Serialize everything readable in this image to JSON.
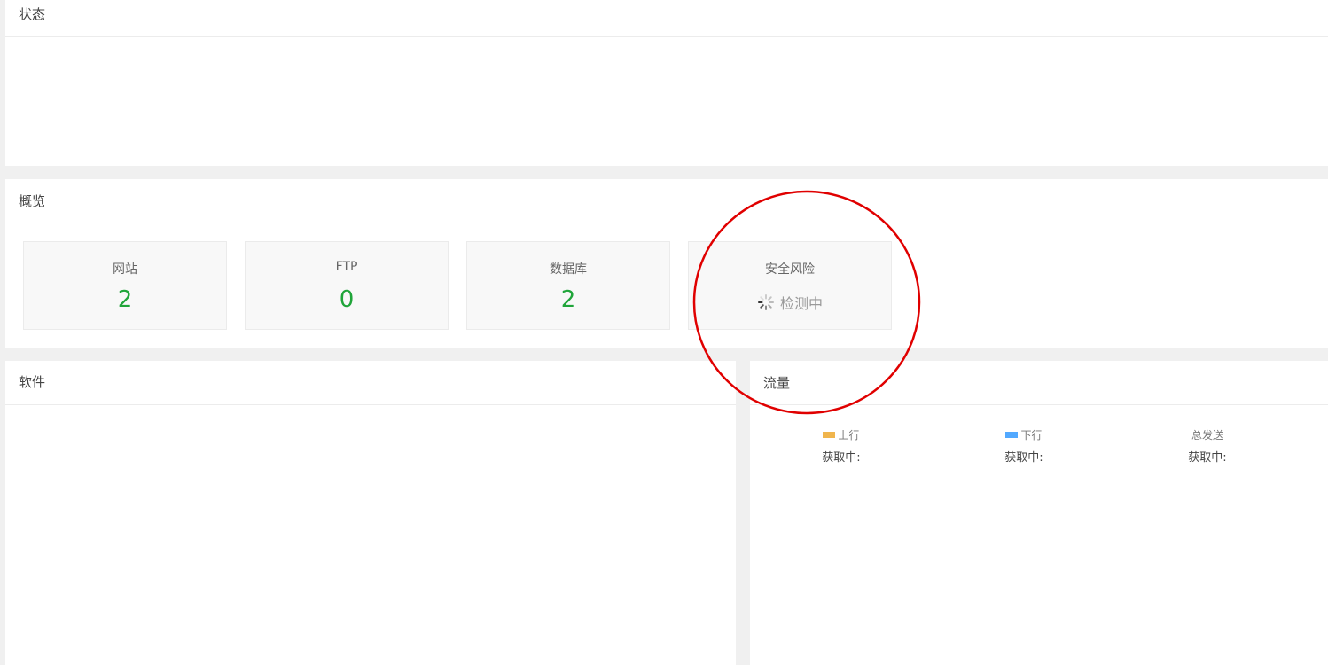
{
  "status_panel": {
    "title": "状态"
  },
  "overview_panel": {
    "title": "概览",
    "cards": [
      {
        "label": "网站",
        "value": "2"
      },
      {
        "label": "FTP",
        "value": "0"
      },
      {
        "label": "数据库",
        "value": "2"
      },
      {
        "label": "安全风险",
        "loading_text": "检测中"
      }
    ]
  },
  "software_panel": {
    "title": "软件"
  },
  "traffic_panel": {
    "title": "流量",
    "columns": [
      {
        "label": "上行",
        "value": "获取中:",
        "color": "#f0b54d"
      },
      {
        "label": "下行",
        "value": "获取中:",
        "color": "#52a9ff"
      },
      {
        "label": "总发送",
        "value": "获取中:"
      }
    ]
  },
  "colors": {
    "accent_green": "#20a53a",
    "annotation_red": "#e00000"
  },
  "icons": {
    "loading": "spinner-icon"
  }
}
